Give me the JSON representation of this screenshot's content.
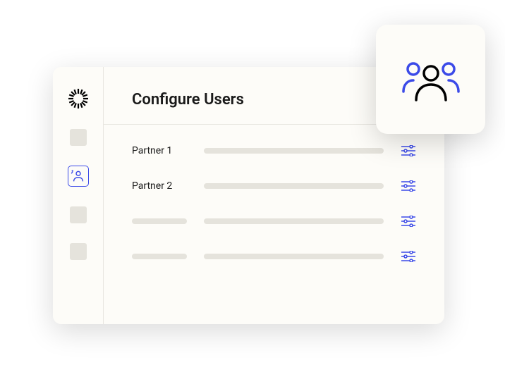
{
  "header": {
    "title": "Configure Users"
  },
  "users": {
    "rows": [
      {
        "label": "Partner 1"
      },
      {
        "label": "Partner 2"
      },
      {
        "label": null
      },
      {
        "label": null
      }
    ]
  },
  "colors": {
    "accent": "#3b4ae8",
    "surface": "#fdfcf8",
    "placeholder": "#e5e3dc"
  }
}
